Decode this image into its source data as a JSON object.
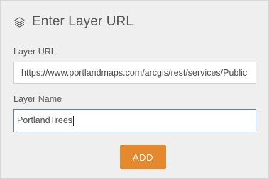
{
  "dialog": {
    "title": "Enter Layer URL",
    "title_icon": "layers-icon"
  },
  "form": {
    "url_label": "Layer URL",
    "url_value": "https://www.portlandmaps.com/arcgis/rest/services/Public",
    "name_label": "Layer Name",
    "name_value": "PortlandTrees"
  },
  "actions": {
    "add_label": "ADD"
  },
  "colors": {
    "accent": "#e5892e",
    "focus_border": "#5a7fb5",
    "panel_bg": "#efefef"
  }
}
